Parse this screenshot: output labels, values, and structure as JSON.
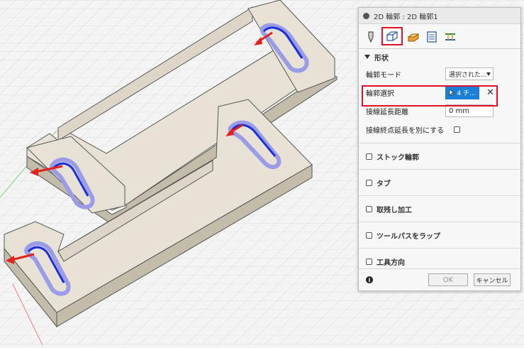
{
  "panel": {
    "title": "2D 輪郭 : 2D 輪郭1",
    "tabs": [
      {
        "icon": "tool-icon"
      },
      {
        "icon": "geometry-icon",
        "active": true
      },
      {
        "icon": "heights-icon"
      },
      {
        "icon": "passes-icon"
      },
      {
        "icon": "linking-icon"
      }
    ],
    "section_title": "形状",
    "contour_mode_label": "輪郭モード",
    "contour_mode_value": "選択された...",
    "contour_selection_label": "輪郭選択",
    "contour_selection_value": "4 チ...",
    "tangent_ext_label": "接線延長距離",
    "tangent_ext_value": "0 mm",
    "separate_tangent_label": "接線終点延長を別にする",
    "groups": [
      {
        "label": "ストック輪郭"
      },
      {
        "label": "タブ"
      },
      {
        "label": "取残し加工"
      },
      {
        "label": "ツールパスをラップ"
      },
      {
        "label": "工具方向"
      }
    ],
    "ok_label": "OK",
    "cancel_label": "キャンセル",
    "info_glyph": "i"
  },
  "colors": {
    "part_top": "#e8e2d6",
    "part_side": "#c4bcab",
    "contour": "#1a2fd8",
    "contour_glow": "#9a9ce8",
    "arrow": "#e3201b",
    "highlight": "#e0102b",
    "selection_button": "#1c7fd6"
  }
}
